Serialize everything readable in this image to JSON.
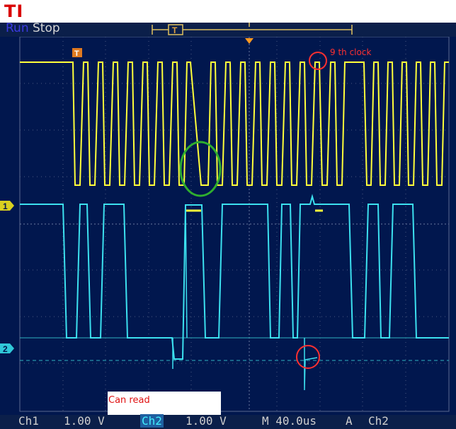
{
  "page_title": "TI",
  "scope": {
    "run_state_prefix": "Run",
    "run_state": "Stop",
    "trigger_marker": "T",
    "ch1_marker": "1",
    "ch2_marker": "2",
    "readout": {
      "ch1_label": "Ch1",
      "ch1_scale": "1.00 V",
      "ch2_label": "Ch2",
      "ch2_scale": "1.00 V",
      "timebase": "M 40.0us",
      "trigger_mode": "A",
      "trigger_source": "Ch2"
    }
  },
  "annotations": {
    "ninth_clock": "9 th clock",
    "can_read": "Can read"
  },
  "colors": {
    "ch1": "#ffff3a",
    "ch2": "#3ce0ef",
    "annotation_red": "#ff3030",
    "annotation_green": "#2fae2f",
    "background": "#01174e"
  }
}
